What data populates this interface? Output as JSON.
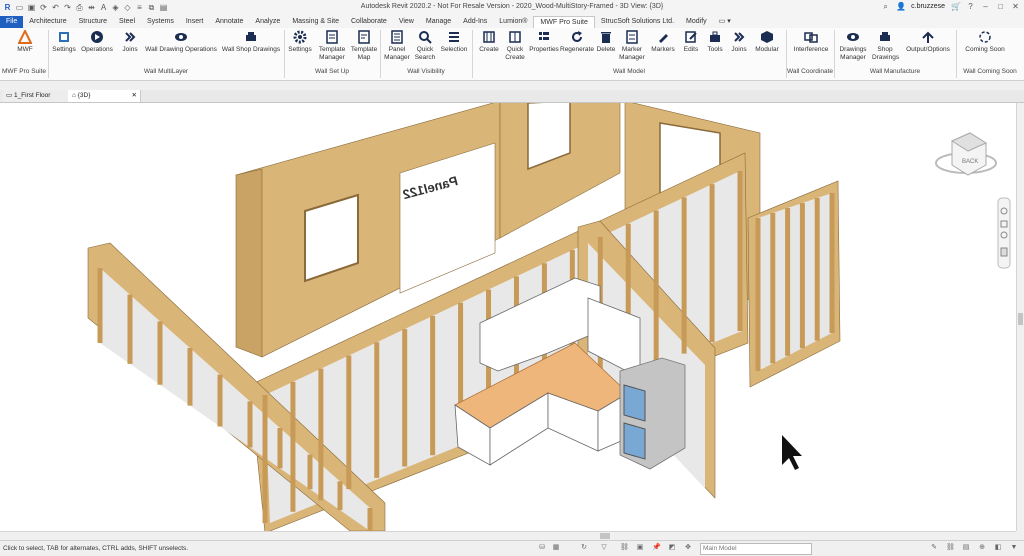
{
  "window": {
    "title": "Autodesk Revit 2020.2 - Not For Resale Version - 2020_Wood-MultiStory-Framed - 3D View: {3D}",
    "username": "c.bruzzese"
  },
  "tabs": [
    "File",
    "Architecture",
    "Structure",
    "Steel",
    "Systems",
    "Insert",
    "Annotate",
    "Analyze",
    "Massing & Site",
    "Collaborate",
    "View",
    "Manage",
    "Add-Ins",
    "Lumion®",
    "MWF Pro Suite",
    "StrucSoft Solutions Ltd.",
    "Modify"
  ],
  "active_tab": "MWF Pro Suite",
  "ribbon": {
    "buttons": {
      "mwf": "MWF",
      "settings1": "Settings",
      "operations1": "Operations",
      "joins1": "Joins",
      "wall_drawing_ops": "Wall Drawing Operations",
      "wall_shop_drawings": "Wall Shop Drawings",
      "settings2": "Settings",
      "template_manager": "Template Manager",
      "template_map": "Template Map",
      "panel_manager": "Panel Manager",
      "quick_search": "Quick Search",
      "selection": "Selection",
      "create": "Create",
      "quick_create": "Quick Create",
      "properties": "Properties",
      "regenerate": "Regenerate",
      "delete": "Delete",
      "marker_manager": "Marker Manager",
      "markers": "Markers",
      "edits": "Edits",
      "tools": "Tools",
      "joins2": "Joins",
      "modular": "Modular",
      "interference": "Interference",
      "drawings_manager": "Drawings Manager",
      "shop_drawings": "Shop Drawings",
      "output_options": "Output/Options",
      "coming_soon": "Coming Soon"
    },
    "panels": {
      "mwf_pro_suite": "MWF Pro Suite",
      "wall_multilayer": "Wall MultiLayer",
      "wall_set_up": "Wall Set Up",
      "wall_visibility": "Wall Visibility",
      "wall_model": "Wall Model",
      "wall_coordinate": "Wall Coordinate",
      "wall_manufacture": "Wall Manufacture",
      "wall_coming_soon": "Wall Coming Soon"
    }
  },
  "view_tabs": {
    "first_floor": "1_First Floor",
    "three_d": "{3D}"
  },
  "viewport": {
    "panel_label": "Panel122",
    "viewcube_face": "BACK"
  },
  "status": {
    "message": "Click to select, TAB for alternates, CTRL adds, SHIFT unselects.",
    "model": "Main Model"
  },
  "colors": {
    "file_tab": "#1f5fbf",
    "wood": "#d9b578",
    "counter": "#efb67b"
  }
}
